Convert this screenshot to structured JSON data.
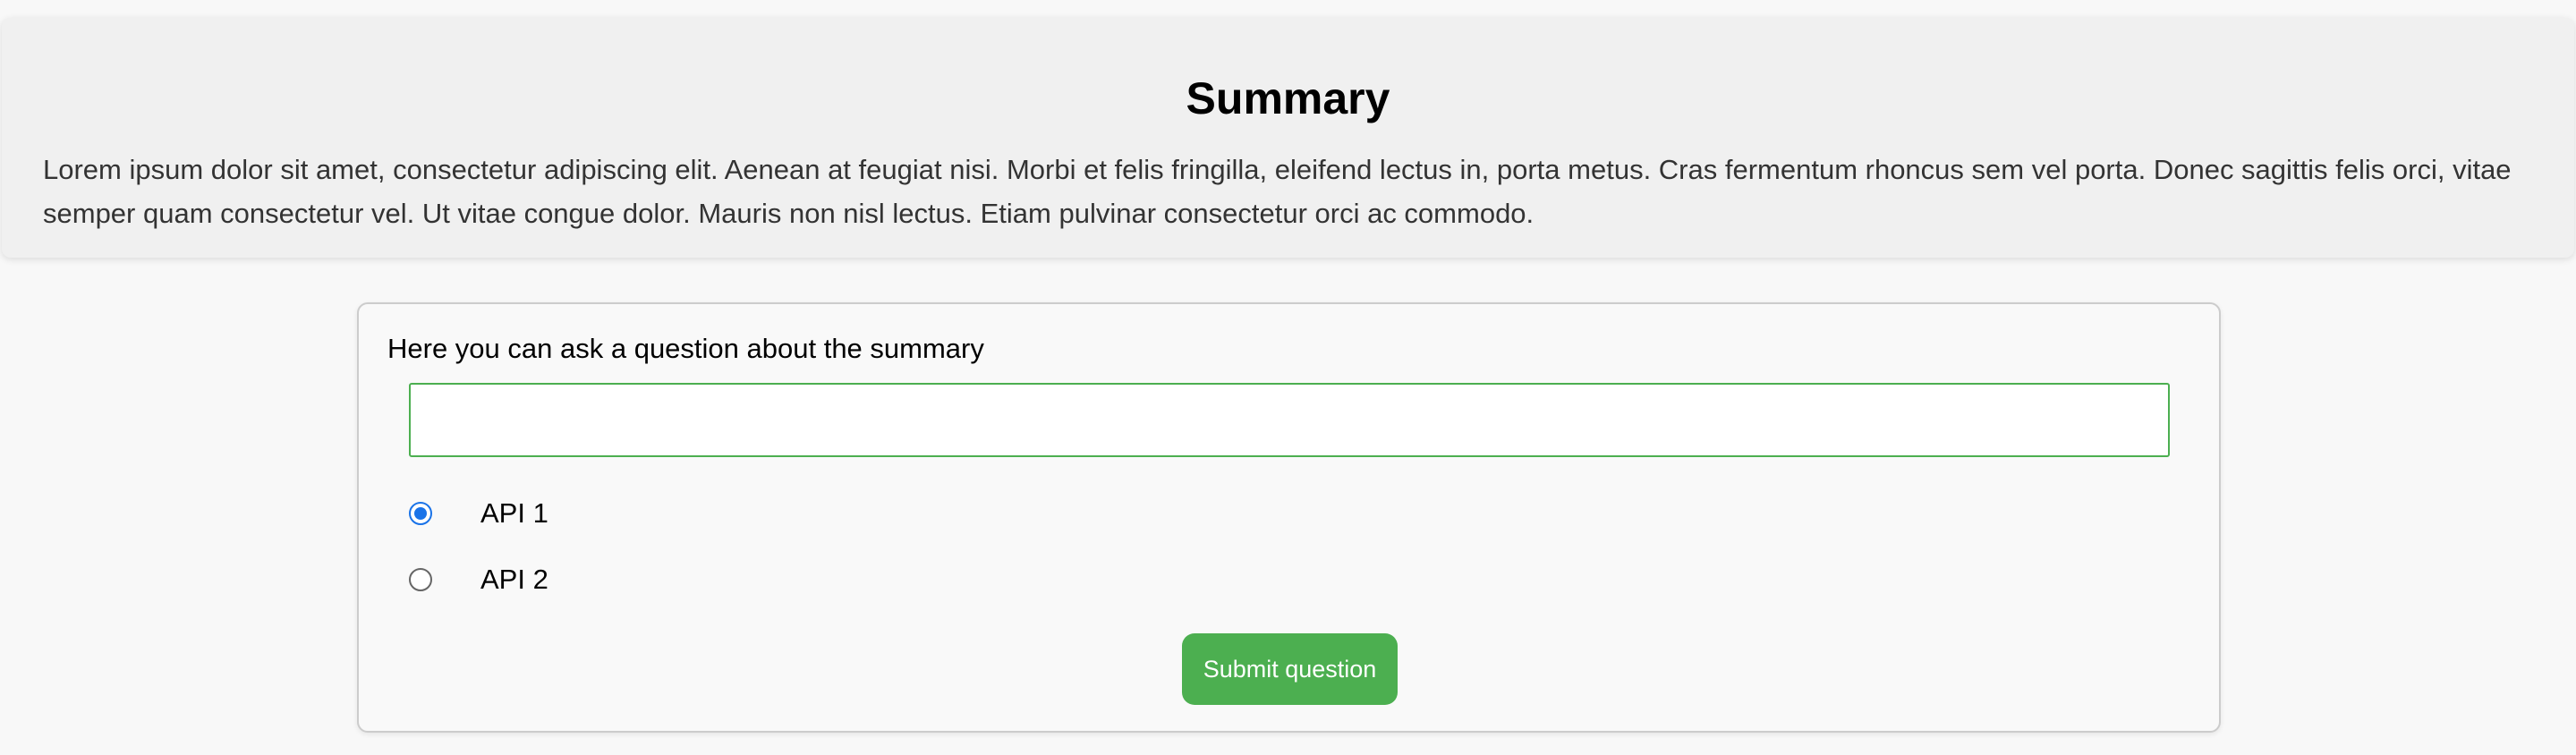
{
  "summary": {
    "title": "Summary",
    "text": "Lorem ipsum dolor sit amet, consectetur adipiscing elit. Aenean at feugiat nisi. Morbi et felis fringilla, eleifend lectus in, porta metus. Cras fermentum rhoncus sem vel porta. Donec sagittis felis orci, vitae semper quam consectetur vel. Ut vitae congue dolor. Mauris non nisl lectus. Etiam pulvinar consectetur orci ac commodo."
  },
  "question_form": {
    "prompt": "Here you can ask a question about the summary",
    "input_value": "",
    "input_placeholder": "",
    "options": [
      {
        "label": "API 1",
        "selected": true
      },
      {
        "label": "API 2",
        "selected": false
      }
    ],
    "submit_label": "Submit question"
  },
  "colors": {
    "accent_green": "#4caf50",
    "radio_blue": "#1a73e8",
    "summary_background": "#f0f0f0",
    "page_background": "#f8f8f8"
  }
}
